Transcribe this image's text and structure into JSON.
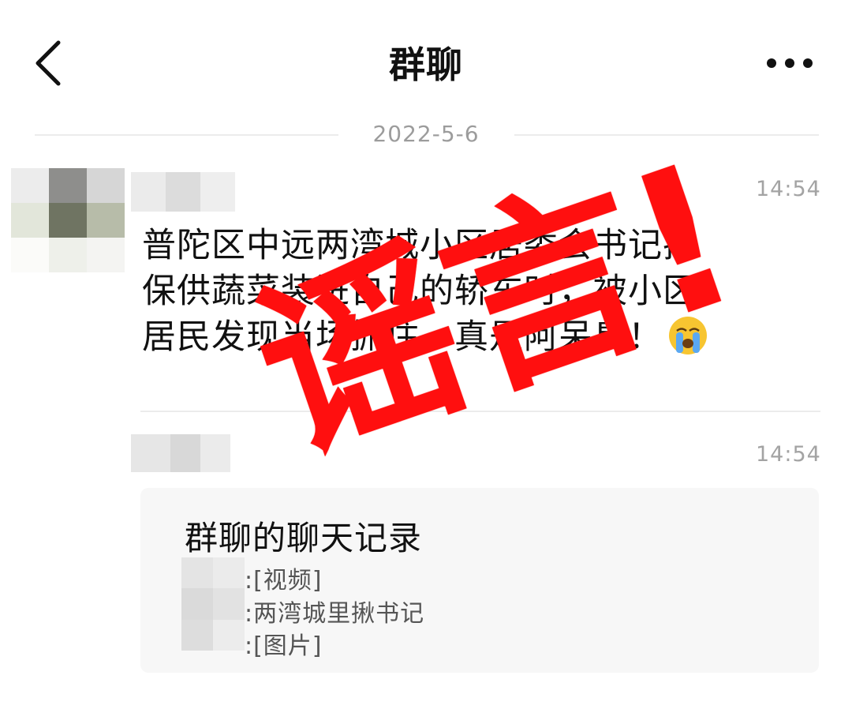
{
  "header": {
    "title": "群聊",
    "back_icon": "chevron-left-icon",
    "more_icon": "more-dots-icon"
  },
  "date_separator": "2022-5-6",
  "messages": [
    {
      "time": "14:54",
      "lines": [
        "普陀区中远两湾城小区居委会书记把",
        "保供蔬菜装进自己的轿车时，被小区",
        "居民发现当场抓住，真是阿呆臭！"
      ],
      "emoji": "crying-face-icon"
    },
    {
      "time": "14:54",
      "record_card": {
        "title": "群聊的聊天记录",
        "items": [
          ":[视频]",
          ":两湾城里揪书记",
          ":[图片]"
        ]
      }
    }
  ],
  "stamp": {
    "text": "谣言!",
    "color": "#ff0f0f"
  }
}
